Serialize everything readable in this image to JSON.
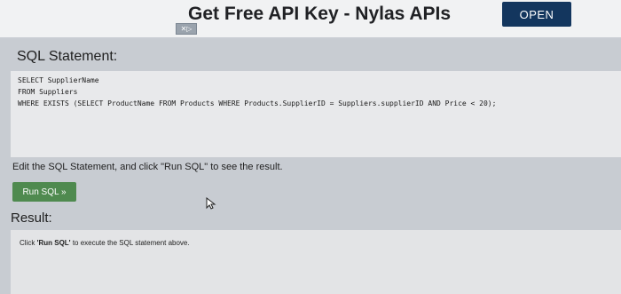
{
  "ad": {
    "title": "Get Free API Key - Nylas APIs",
    "marker": "✕▷",
    "open_label": "OPEN"
  },
  "sql": {
    "title": "SQL Statement:",
    "lines": [
      "SELECT SupplierName",
      "FROM Suppliers",
      "WHERE EXISTS (SELECT ProductName FROM Products WHERE Products.SupplierID = Suppliers.supplierID AND Price < 20);"
    ]
  },
  "instructions": "Edit the SQL Statement, and click \"Run SQL\" to see the result.",
  "run_button_label": "Run SQL »",
  "result": {
    "title": "Result:",
    "message_prefix": "Click ",
    "message_bold": "'Run SQL'",
    "message_suffix": " to execute the SQL statement above."
  }
}
